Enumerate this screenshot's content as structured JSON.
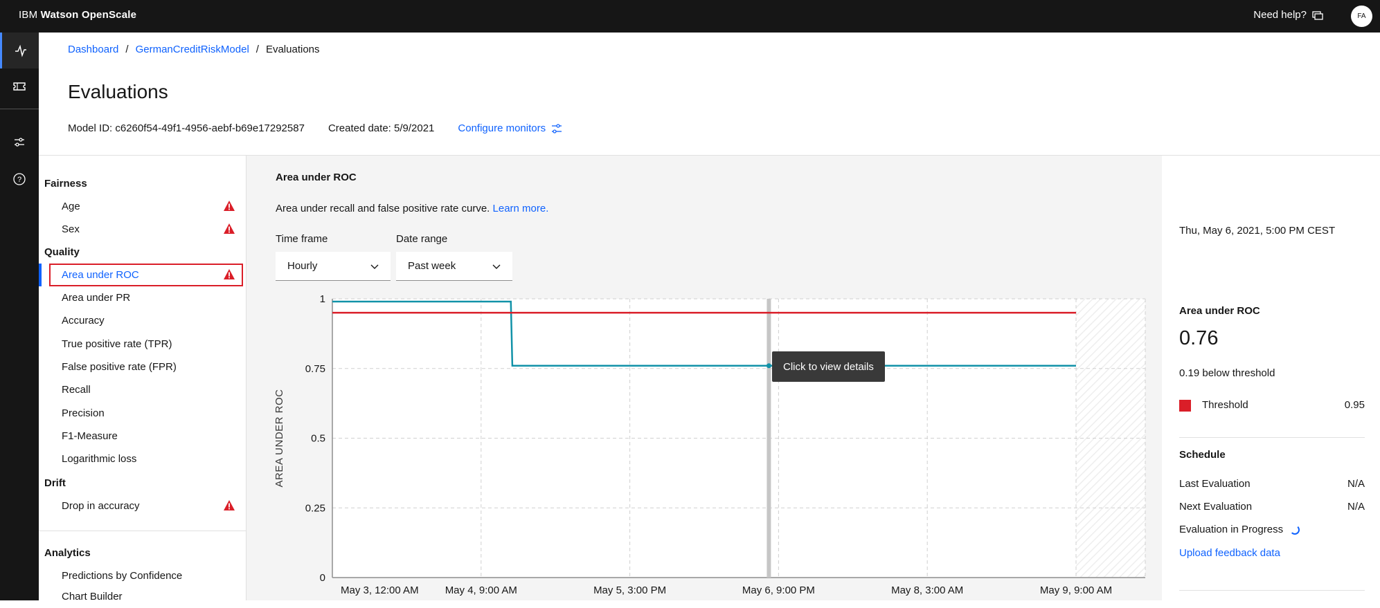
{
  "topbar": {
    "brand_prefix": "IBM",
    "brand_name": "Watson OpenScale",
    "help_label": "Need help?",
    "avatar_initials": "FA"
  },
  "breadcrumb": {
    "items": [
      "Dashboard",
      "GermanCreditRiskModel",
      "Evaluations"
    ],
    "separator": "/"
  },
  "page": {
    "title": "Evaluations",
    "model_id": "Model ID: c6260f54-49f1-4956-aebf-b69e17292587",
    "created_date": "Created date: 5/9/2021",
    "configure_label": "Configure monitors"
  },
  "nav": {
    "groups": [
      {
        "label": "Fairness",
        "items": [
          {
            "label": "Age",
            "warn": true
          },
          {
            "label": "Sex",
            "warn": true
          }
        ]
      },
      {
        "label": "Quality",
        "items": [
          {
            "label": "Area under ROC",
            "warn": true,
            "selected": true
          },
          {
            "label": "Area under PR",
            "warn": false
          },
          {
            "label": "Accuracy",
            "warn": false
          },
          {
            "label": "True positive rate (TPR)",
            "warn": false
          },
          {
            "label": "False positive rate (FPR)",
            "warn": false
          },
          {
            "label": "Recall",
            "warn": false
          },
          {
            "label": "Precision",
            "warn": false
          },
          {
            "label": "F1-Measure",
            "warn": false
          },
          {
            "label": "Logarithmic loss",
            "warn": false
          }
        ]
      },
      {
        "label": "Drift",
        "items": [
          {
            "label": "Drop in accuracy",
            "warn": true
          }
        ]
      },
      {
        "label": "Analytics",
        "items": [
          {
            "label": "Predictions by Confidence",
            "warn": false
          },
          {
            "label": "Chart Builder",
            "warn": false
          }
        ]
      }
    ]
  },
  "main": {
    "heading": "Area under ROC",
    "description": "Area under recall and false positive rate curve.",
    "learn_more": "Learn more.",
    "time_frame": {
      "label": "Time frame",
      "value": "Hourly"
    },
    "date_range": {
      "label": "Date range",
      "value": "Past week"
    },
    "tooltip": "Click to view details"
  },
  "chart_data": {
    "type": "line",
    "ylabel": "AREA UNDER ROC",
    "ylim": [
      0,
      1
    ],
    "yticks": [
      "1",
      "0.75",
      "0.5",
      "0.25",
      "0"
    ],
    "xticks": [
      "May 3, 12:00 AM",
      "May 4, 9:00 AM",
      "May 5, 3:00 PM",
      "May 6, 9:00 PM",
      "May 8, 3:00 AM",
      "May 9, 9:00 AM"
    ],
    "grid": true,
    "series": [
      {
        "color": "#1192a8",
        "x": [
          0,
          0.5,
          1,
          1.5,
          2,
          2.4,
          2.42,
          3,
          4,
          5,
          5.5,
          6,
          7,
          8,
          9,
          10
        ],
        "values": [
          0.99,
          0.99,
          0.99,
          0.99,
          0.99,
          0.99,
          0.76,
          0.76,
          0.76,
          0.76,
          0.76,
          0.76,
          0.76,
          0.76,
          0.76,
          0.76
        ]
      },
      {
        "color": "#da1e28",
        "x": [
          0,
          10
        ],
        "values": [
          0.95,
          0.95
        ]
      }
    ],
    "selected_x": 5.87
  },
  "right": {
    "date": "Thu, May 6, 2021, 5:00 PM CEST",
    "metric_title": "Area under ROC",
    "metric_value": "0.76",
    "below": "0.19 below threshold",
    "threshold_label": "Threshold",
    "threshold_value": "0.95",
    "schedule_title": "Schedule",
    "last_eval_label": "Last Evaluation",
    "last_eval_value": "N/A",
    "next_eval_label": "Next Evaluation",
    "next_eval_value": "N/A",
    "progress_label": "Evaluation in Progress",
    "upload_link": "Upload feedback data"
  },
  "colors": {
    "accent": "#0f62fe",
    "danger": "#da1e28",
    "series": "#1192a8"
  }
}
